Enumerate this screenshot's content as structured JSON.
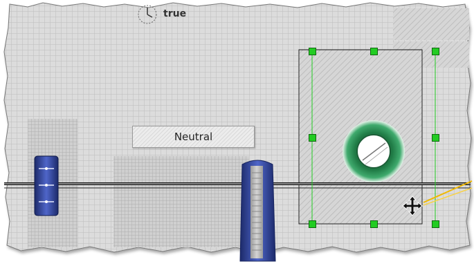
{
  "canvas": {
    "indicator_label": "true",
    "button_label": "Neutral"
  },
  "colors": {
    "grid_background": "#d9d9d9",
    "grid_line": "#b8b8b8",
    "selection_handle": "#22cc22",
    "selection_guide": "#22cc22",
    "ring_outer": "#2e8b57",
    "ring_inner": "#ffffff",
    "slider_blue": "#2a3e8f",
    "connector_line": "#f0b800"
  },
  "icons": {
    "indicator": "clock-icon",
    "cursor": "move-cursor-icon",
    "knob": "ring-knob-icon"
  }
}
